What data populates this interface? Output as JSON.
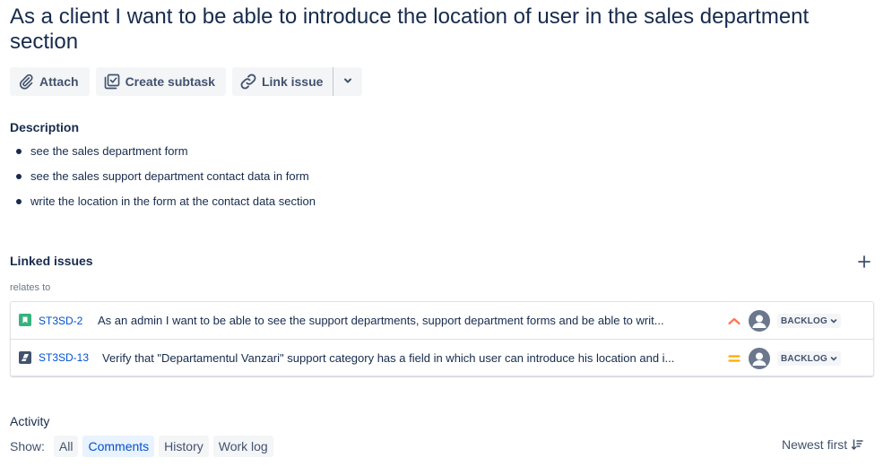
{
  "issue": {
    "title": "As a client I want to be able to introduce the location of user in the sales department section"
  },
  "toolbar": {
    "attach_label": "Attach",
    "create_subtask_label": "Create subtask",
    "link_issue_label": "Link issue",
    "icons": [
      "paperclip-icon",
      "subtask-icon",
      "link-icon",
      "chevron-down-icon"
    ]
  },
  "description": {
    "heading": "Description",
    "items": [
      "see the sales department form",
      "see the sales support department contact data in form",
      "write the location in the form at the contact data section"
    ]
  },
  "linked_issues": {
    "heading": "Linked issues",
    "relation": "relates to",
    "items": [
      {
        "key": "ST3SD-2",
        "summary": "As an admin I want to be able to see the support departments, support department forms and be able to writ...",
        "type_icon": "story-icon",
        "priority_icon": "priority-high-icon",
        "status": "BACKLOG"
      },
      {
        "key": "ST3SD-13",
        "summary": "Verify that \"Departamentul Vanzari\" support category has a field in which user can introduce his location and i...",
        "type_icon": "test-icon",
        "priority_icon": "priority-medium-icon",
        "status": "BACKLOG"
      }
    ]
  },
  "activity": {
    "heading": "Activity",
    "show_label": "Show:",
    "filters": [
      "All",
      "Comments",
      "History",
      "Work log"
    ],
    "active_filter": "Comments",
    "sort_label": "Newest first"
  },
  "colors": {
    "text": "#172b4d",
    "link": "#0052cc",
    "priority_high": "#ff7452",
    "priority_medium": "#ffab00",
    "story_green": "#36b37e"
  }
}
